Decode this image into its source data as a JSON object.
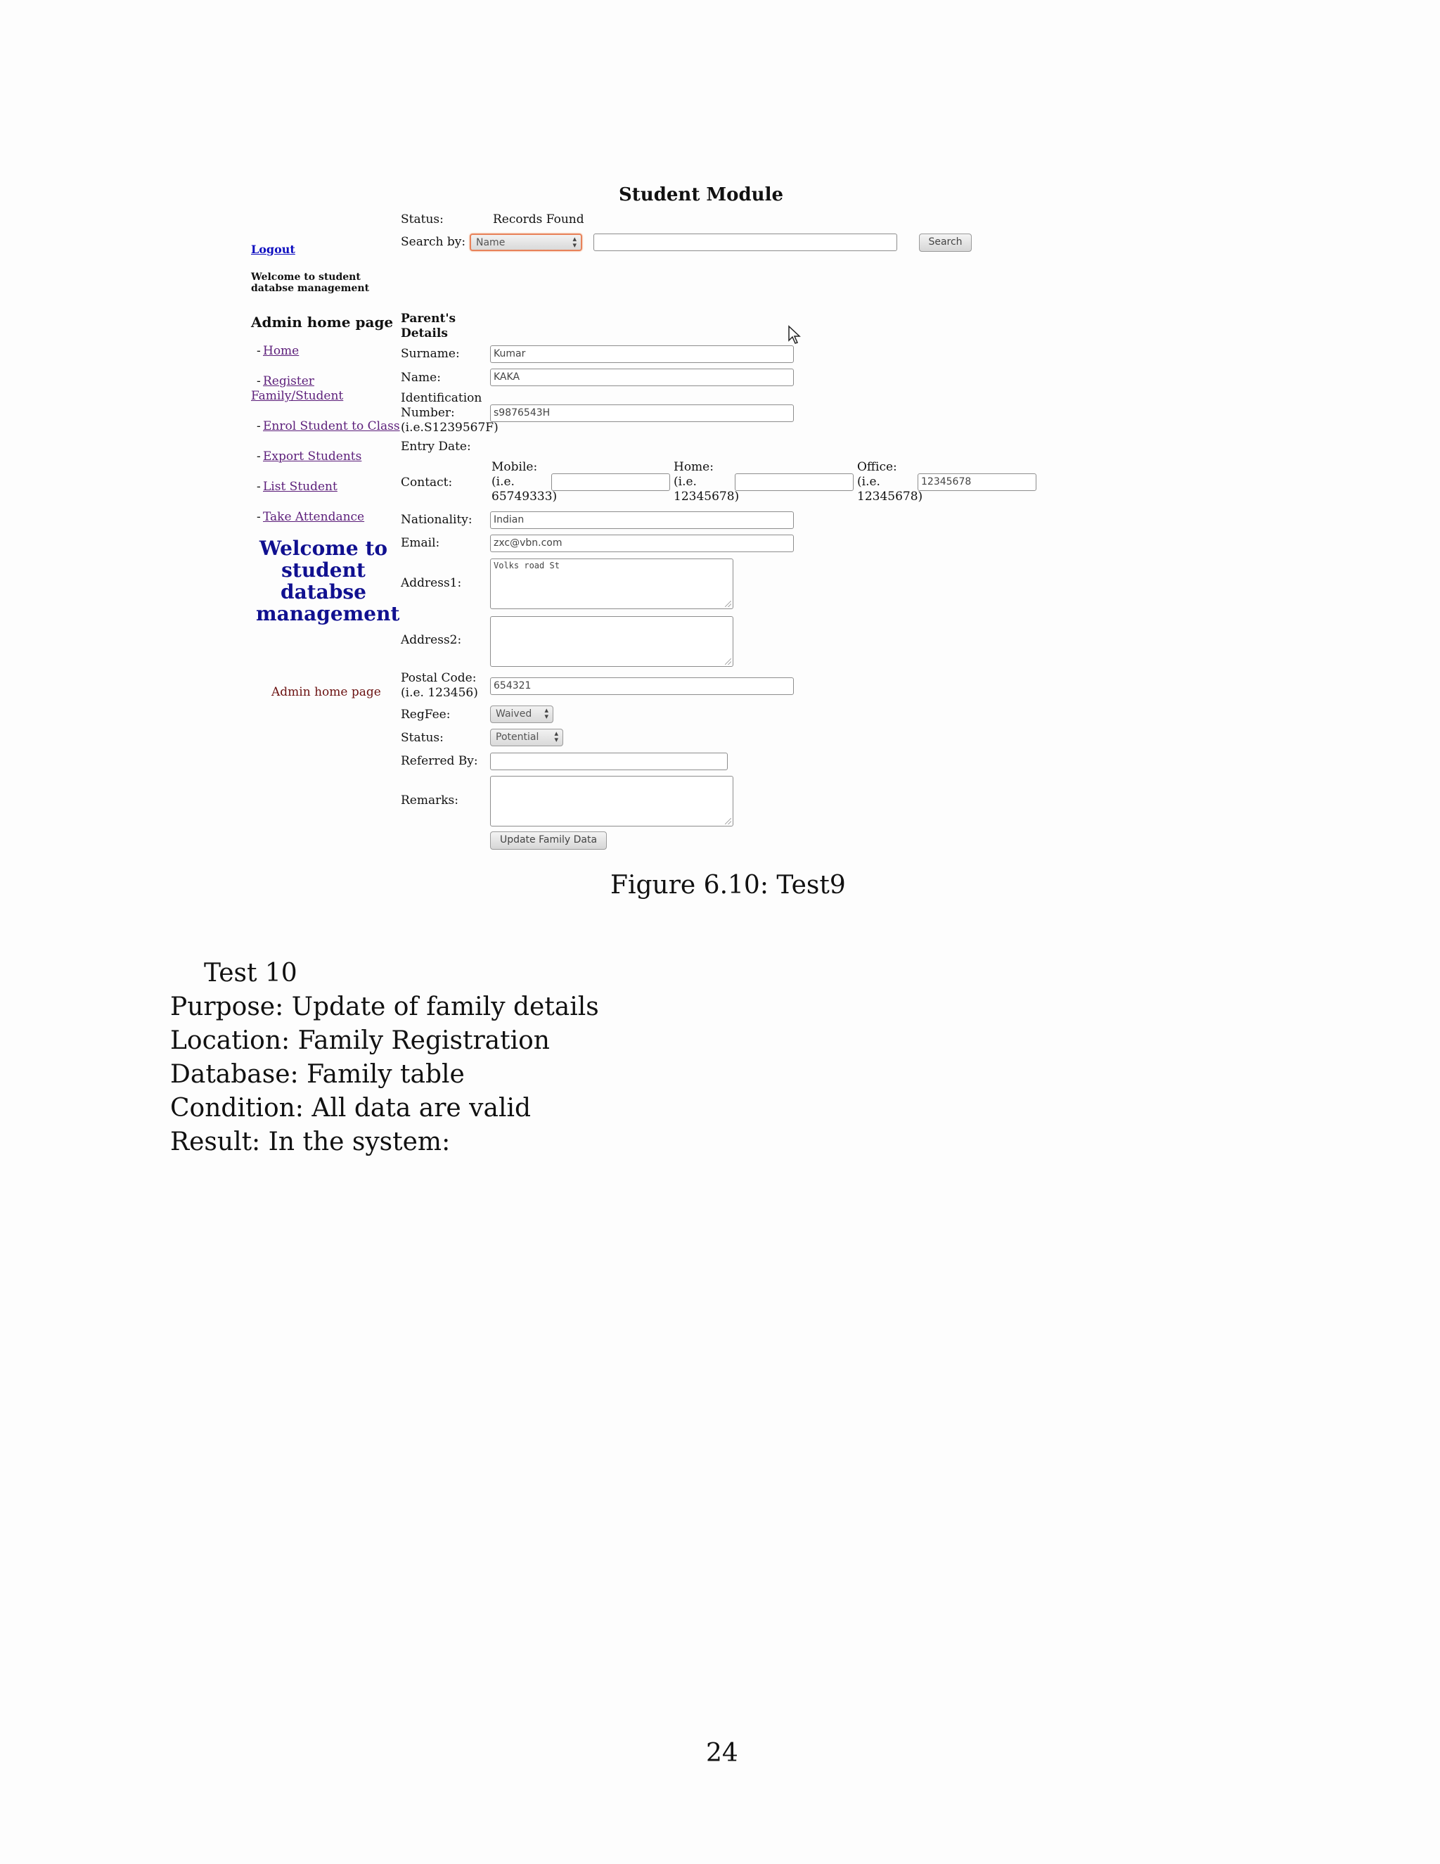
{
  "screenshot": {
    "module_title": "Student Module",
    "status_label": "Status:",
    "status_value": "Records Found",
    "search_by_label": "Search by:",
    "search_by_value": "Name",
    "search_input_value": "",
    "search_button": "Search",
    "sidebar": {
      "logout": "Logout",
      "welcome_small": "Welcome to student databse management",
      "admin_heading": "Admin home page",
      "nav_items": [
        "Home",
        "Register Family/Student",
        "Enrol Student to Class",
        "Export Students",
        "List Student",
        "Take Attendance"
      ],
      "welcome_big": "Welcome to student databse management",
      "admin_small": "Admin home page"
    },
    "form": {
      "section_title": "Parent's Details",
      "surname_label": "Surname:",
      "surname_value": "Kumar",
      "name_label": "Name:",
      "name_value": "KAKA",
      "id_label_1": "Identification",
      "id_label_2": "Number:",
      "id_label_3": "(i.e.S1239567F)",
      "id_value": "s9876543H",
      "entry_date_label": "Entry Date:",
      "contact_label": "Contact:",
      "mobile_label_1": "Mobile:",
      "mobile_label_2": "(i.e.",
      "mobile_label_3": "65749333)",
      "mobile_value": "",
      "home_label_1": "Home:",
      "home_label_2": "(i.e.",
      "home_label_3": "12345678)",
      "home_value": "",
      "office_label_1": "Office:",
      "office_label_2": "(i.e.",
      "office_label_3": "12345678)",
      "office_value": "12345678",
      "nationality_label": "Nationality:",
      "nationality_value": "Indian",
      "email_label": "Email:",
      "email_value": "zxc@vbn.com",
      "address1_label": "Address1:",
      "address1_value": "Volks road St",
      "address2_label": "Address2:",
      "address2_value": "",
      "postal_label_1": "Postal Code:",
      "postal_label_2": "(i.e. 123456)",
      "postal_value": "654321",
      "regfee_label": "RegFee:",
      "regfee_value": "Waived",
      "status_label": "Status:",
      "status_value": "Potential",
      "referred_label": "Referred By:",
      "referred_value": "",
      "remarks_label": "Remarks:",
      "remarks_value": "",
      "update_button": "Update Family Data"
    }
  },
  "document": {
    "caption": "Figure 6.10: Test9",
    "lines": [
      "Test 10",
      "Purpose: Update of family details",
      "Location: Family Registration",
      "Database: Family table",
      "Condition: All data are valid",
      "Result: In the system:"
    ],
    "page_number": "24"
  }
}
